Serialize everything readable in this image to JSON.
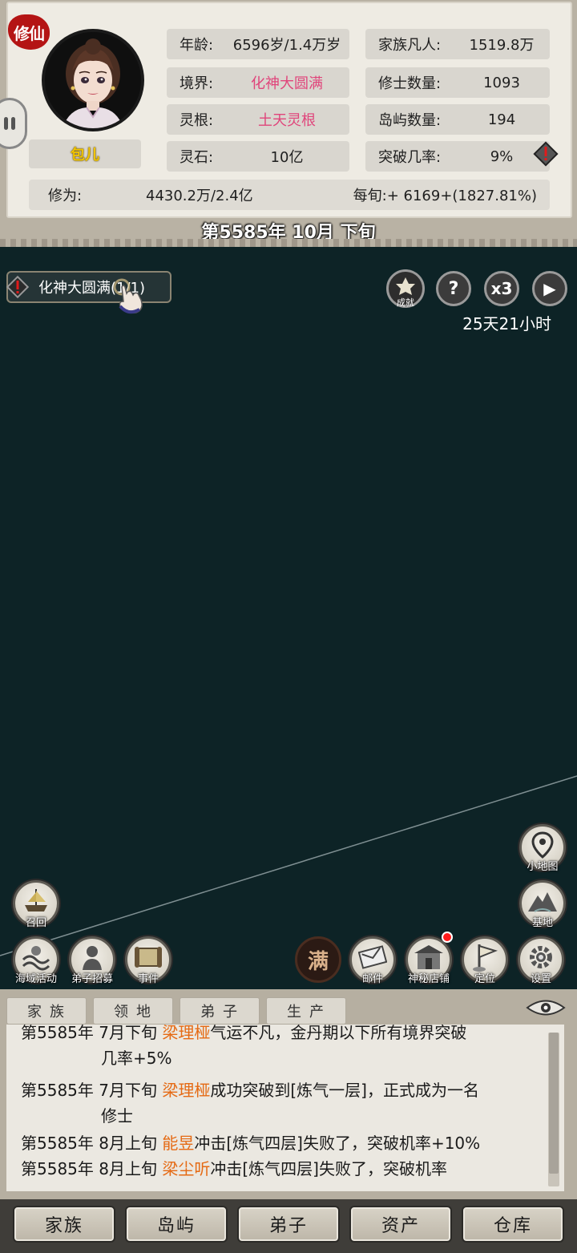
{
  "seal_text": "修仙",
  "character_name": "包儿",
  "stats": {
    "age_label": "年龄:",
    "age_value": "6596岁/1.4万岁",
    "realm_label": "境界:",
    "realm_value": "化神大圆满",
    "root_label": "灵根:",
    "root_value": "土天灵根",
    "stone_label": "灵石:",
    "stone_value": "10亿",
    "mortals_label": "家族凡人:",
    "mortals_value": "1519.8万",
    "cultivators_label": "修士数量:",
    "cultivators_value": "1093",
    "islands_label": "岛屿数量:",
    "islands_value": "194",
    "breakthrough_label": "突破几率:",
    "breakthrough_value": "9%",
    "cultivation_label": "修为:",
    "cultivation_value": "4430.2万/2.4亿",
    "per_period": "每旬:+ 6169+(1827.81%)"
  },
  "date": "第5585年 10月 下旬",
  "quest": "化神大圆满(1/1)",
  "top_buttons": {
    "achievement_label": "成就",
    "help_symbol": "?",
    "speed": "x3",
    "play_symbol": "▶"
  },
  "timer": "25天21小时",
  "tools_left": [
    {
      "label": "召回",
      "icon": "ship-icon"
    },
    {
      "label": "海域活动",
      "icon": "sea-icon"
    },
    {
      "label": "弟子招募",
      "icon": "disciple-icon"
    },
    {
      "label": "事件",
      "icon": "scroll-icon"
    }
  ],
  "tools_right": [
    {
      "label": "小地图",
      "icon": "map-pin-icon"
    },
    {
      "label": "基地",
      "icon": "mountain-icon"
    },
    {
      "label": "邮件",
      "icon": "mail-icon"
    },
    {
      "label": "神秘店铺",
      "icon": "shop-icon"
    },
    {
      "label": "定位",
      "icon": "flag-icon"
    },
    {
      "label": "设置",
      "icon": "gear-icon"
    }
  ],
  "full_label": "满",
  "log_tabs": [
    "家族",
    "领地",
    "弟子",
    "生产"
  ],
  "log_entries": [
    {
      "prefix": "第5585年 7月下旬 ",
      "name": "梁理桠",
      "text": "气运不凡，金丹期以下所有境界突破",
      "cont": "几率+5%"
    },
    {
      "prefix": "第5585年 7月下旬 ",
      "name": "梁理桠",
      "text": "成功突破到[炼气一层]，正式成为一名",
      "cont": "修士"
    },
    {
      "prefix": "第5585年 8月上旬 ",
      "name": "能昱",
      "text": "冲击[炼气四层]失败了，突破机率+10%",
      "cont": ""
    },
    {
      "prefix": "第5585年 8月上旬 ",
      "name": "梁尘听",
      "text": "冲击[炼气四层]失败了，突破机率",
      "cont": ""
    }
  ],
  "bottom_nav": [
    "家族",
    "岛屿",
    "弟子",
    "资产",
    "仓库"
  ],
  "colors": {
    "map_bg": "#0d2326",
    "pink_value": "#e0457b",
    "log_name": "#e56a14",
    "seal": "#b41414"
  }
}
